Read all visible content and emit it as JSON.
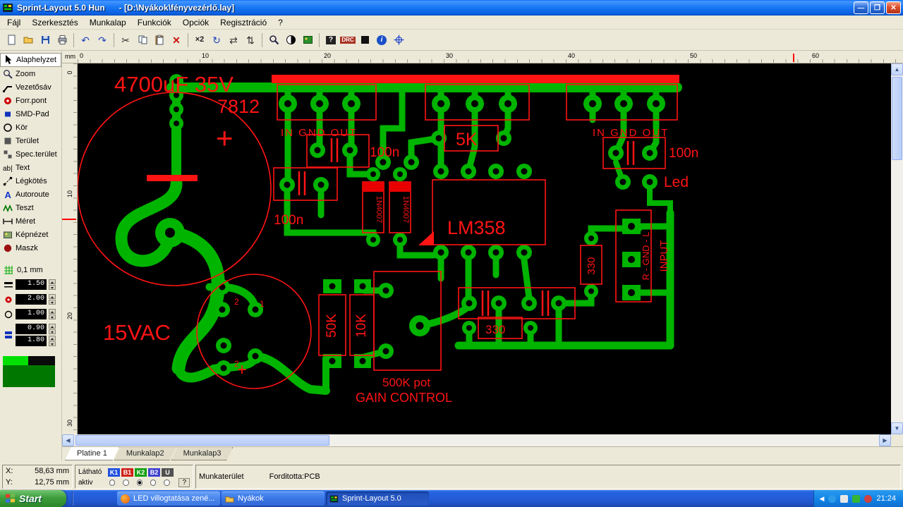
{
  "window": {
    "title": "Sprint-Layout 5.0 Hun      - [D:\\Nyákok\\fényvezérlő.lay]",
    "minimize": "—",
    "maximize": "❐",
    "close": "✕"
  },
  "menubar": {
    "items": [
      "Fájl",
      "Szerkesztés",
      "Munkalap",
      "Funkciók",
      "Opciók",
      "Regisztráció",
      "?"
    ]
  },
  "toolbar": {
    "icons": [
      {
        "name": "new-file"
      },
      {
        "name": "open-folder"
      },
      {
        "name": "save"
      },
      {
        "name": "print"
      },
      {
        "name": "undo",
        "glyph": "↶"
      },
      {
        "name": "redo",
        "glyph": "↷"
      },
      {
        "name": "cut",
        "glyph": "✂"
      },
      {
        "name": "copy"
      },
      {
        "name": "paste"
      },
      {
        "name": "delete",
        "glyph": "✕"
      },
      {
        "name": "zoom-x2",
        "glyph": "×2"
      },
      {
        "name": "rotate",
        "glyph": "↻"
      },
      {
        "name": "mirror-horizontal",
        "glyph": "⇄"
      },
      {
        "name": "mirror-vertical",
        "glyph": "⇅"
      },
      {
        "name": "zoom-lens"
      },
      {
        "name": "contrast"
      },
      {
        "name": "photo-view"
      },
      {
        "name": "component-search",
        "glyph": "?"
      },
      {
        "name": "drc",
        "glyph": "DRC"
      },
      {
        "name": "mask"
      },
      {
        "name": "info",
        "glyph": "i"
      },
      {
        "name": "snap-crosshair"
      }
    ]
  },
  "toolbox": {
    "tools": [
      {
        "label": "Alaphelyzet"
      },
      {
        "label": "Zoom"
      },
      {
        "label": "Vezetősáv"
      },
      {
        "label": "Forr.pont"
      },
      {
        "label": "SMD-Pad"
      },
      {
        "label": "Kör"
      },
      {
        "label": "Terület"
      },
      {
        "label": "Spec.terület"
      },
      {
        "label": "Text"
      },
      {
        "label": "Légkötés"
      },
      {
        "label": "Autoroute"
      },
      {
        "label": "Teszt"
      },
      {
        "label": "Méret"
      },
      {
        "label": "Képnézet"
      },
      {
        "label": "Maszk"
      }
    ],
    "grid_value": "0,1 mm",
    "spinners": [
      "1.50",
      "2.00",
      "1.00",
      "0.90",
      "1.80"
    ]
  },
  "rulers": {
    "unit": "mm",
    "top_ticks": [
      "0",
      "10",
      "20",
      "30",
      "40",
      "50",
      "60"
    ],
    "left_ticks": [
      "0",
      "10",
      "20",
      "30"
    ]
  },
  "pcb": {
    "labels": [
      "4700uF 35V",
      "7812",
      "+",
      "IN   GND   OUT",
      "100n",
      "5K",
      "100n",
      "1N4007",
      "1N4007",
      "LM358",
      "IN   GND   OUT",
      "100n",
      "Led",
      "330",
      "330",
      "INPUT",
      "R - GND - L",
      "15VAC",
      "50K",
      "10K",
      "500K pot",
      "GAIN CONTROL",
      "+",
      "2",
      "1",
      "2"
    ],
    "colors": {
      "trace": "#00b400",
      "silk": "#ff1414",
      "board": "#000000"
    }
  },
  "sheet_tabs": [
    {
      "label": "Platine 1"
    },
    {
      "label": "Munkalap2"
    },
    {
      "label": "Munkalap3"
    }
  ],
  "statusbar": {
    "x_label": "X:",
    "x_value": "58,63 mm",
    "y_label": "Y:",
    "y_value": "12,75 mm",
    "visible_label": "Látható",
    "active_label": "aktiv",
    "layers": [
      "K1",
      "B1",
      "K2",
      "B2",
      "U"
    ],
    "help": "?",
    "workspace": "Munkaterület",
    "translator": "Forditotta:PCB"
  },
  "taskbar": {
    "start_label": "Start",
    "tasks": [
      "LED villogtatása zené...",
      "Nyákok",
      "Sprint-Layout 5.0"
    ],
    "clock": "21:24"
  }
}
